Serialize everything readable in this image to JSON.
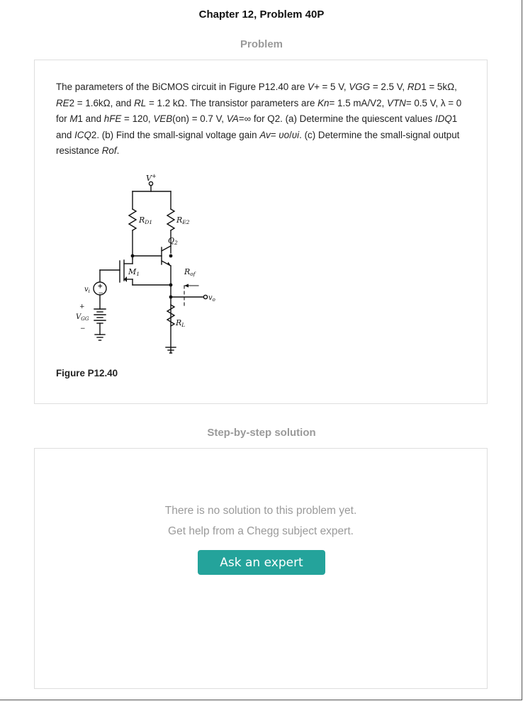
{
  "header": {
    "chapter_title": "Chapter 12, Problem 40P"
  },
  "problem": {
    "heading": "Problem",
    "text": {
      "p01": "The parameters of the BiCMOS circuit in Figure P12.40 are ",
      "p02": "V+",
      "p03": " = 5 V, ",
      "p04": "VGG",
      "p05": " = 2.5 V, ",
      "p06": "RD",
      "p07": "1 = 5kΩ, ",
      "p08": "RE",
      "p09": "2 = 1.6kΩ, and ",
      "p10": "RL",
      "p11": " = 1.2 kΩ. The transistor parameters are ",
      "p12": "Kn",
      "p13": "= 1.5 mA/V2, ",
      "p14": "VTN",
      "p15": "= 0.5 V, λ = 0 for ",
      "p16": "M",
      "p17": "1 and ",
      "p18": "hFE",
      "p19": " = 120, ",
      "p20": "VEB",
      "p21": "(on) = 0.7 V, ",
      "p22": "VA",
      "p23": "=∞ for Q2. (a) Determine the quiescent values ",
      "p24": "IDQ",
      "p25": "1 and ",
      "p26": "ICQ",
      "p27": "2. (b) Find the small-signal voltage gain ",
      "p28": "Av",
      "p29": "= ",
      "p30": "υo",
      "p31": "/",
      "p32": "υi",
      "p33": ". (c) Determine the small-signal output resistance ",
      "p34": "Rof",
      "p35": "."
    },
    "figure": {
      "caption": "Figure P12.40",
      "labels": {
        "vplus_main": "V",
        "vplus_sup": "+",
        "rd1_main": "R",
        "rd1_sub": "D1",
        "re2_main": "R",
        "re2_sub": "E2",
        "q2_main": "Q",
        "q2_sub": "2",
        "m1_main": "M",
        "m1_sub": "1",
        "rof_main": "R",
        "rof_sub": "of",
        "vo_main": "v",
        "vo_sub": "o",
        "vi_main": "v",
        "vi_sub": "i",
        "rl_main": "R",
        "rl_sub": "L",
        "vgg_main": "V",
        "vgg_sub": "GG",
        "vgg_plus": "+",
        "vgg_minus": "−",
        "src_plus": "+",
        "src_minus": "−"
      }
    }
  },
  "solution": {
    "heading": "Step-by-step solution",
    "empty_line1": "There is no solution to this problem yet.",
    "empty_line2": "Get help from a Chegg subject expert.",
    "ask_button": "Ask an expert"
  },
  "colors": {
    "accent": "#24a39b",
    "muted_text": "#9a9a9a",
    "panel_border": "#dedede"
  }
}
